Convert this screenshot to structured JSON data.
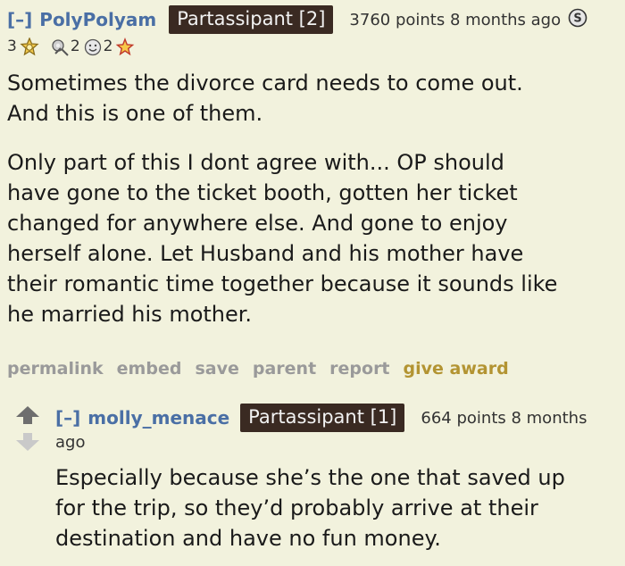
{
  "comment1": {
    "toggle": "[–]",
    "author": "PolyPolyam",
    "flair": "Partassipant [2]",
    "score_time": "3760 points 8 months ago",
    "awards": [
      {
        "count": "3",
        "icon": "gold-award-icon"
      },
      {
        "count": "2",
        "icon": "silver-award-icon"
      },
      {
        "count": "2",
        "icon": "face-award-icon"
      },
      {
        "icon": "star-award-icon"
      }
    ],
    "paragraphs": [
      "Sometimes the divorce card needs to come out.\nAnd this is one of them.",
      "Only part of this I dont agree with... OP should\nhave gone to the ticket booth, gotten her ticket\nchanged for anywhere else. And gone to enjoy\nherself alone. Let Husband and his mother have\ntheir romantic time together because it sounds like\nhe married his mother."
    ],
    "links": [
      "permalink",
      "embed",
      "save",
      "parent",
      "report"
    ],
    "give_award": "give award"
  },
  "comment2": {
    "toggle": "[–]",
    "author": "molly_menace",
    "flair": "Partassipant [1]",
    "score_time": "664 points 8 months",
    "score_time_wrap": "ago",
    "paragraphs": [
      "Especially because she’s the one that saved up\nfor the trip, so they’d probably arrive at their\ndestination and have no fun money."
    ]
  }
}
